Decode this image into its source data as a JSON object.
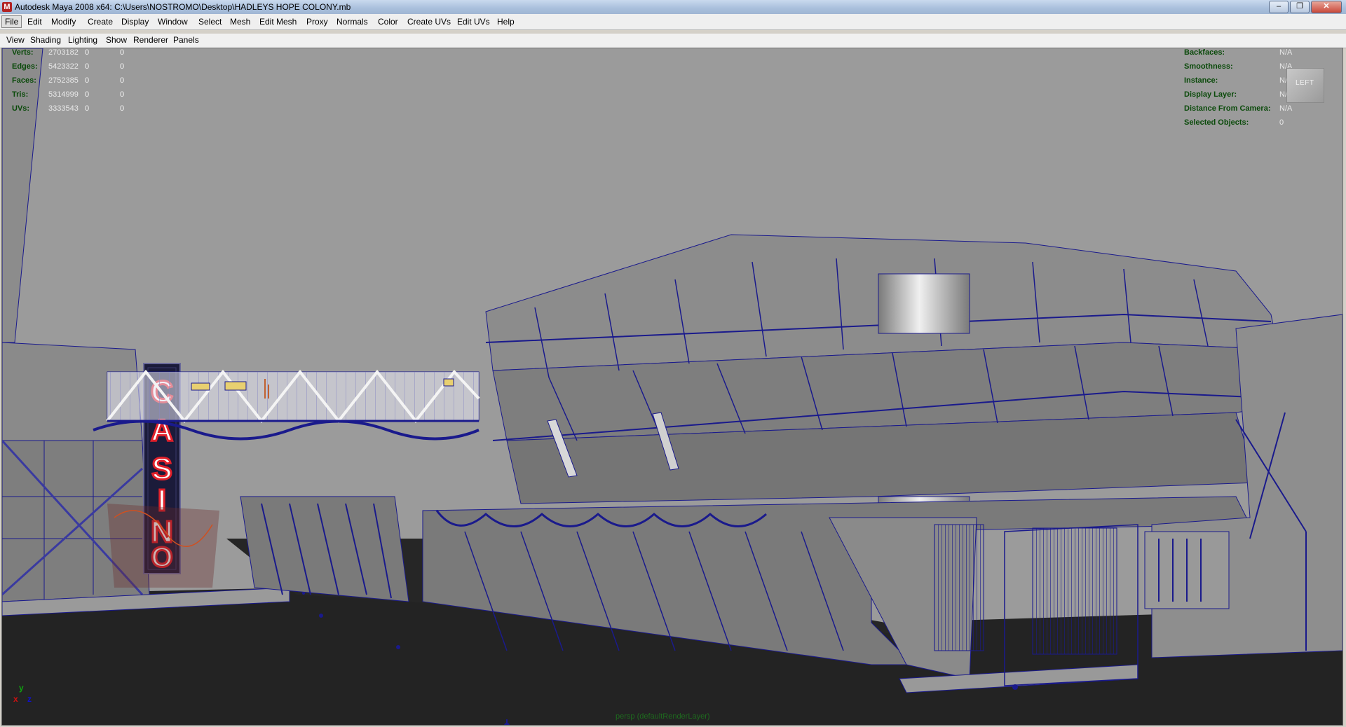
{
  "window": {
    "title": "Autodesk Maya 2008 x64: C:\\Users\\NOSTROMO\\Desktop\\HADLEYS HOPE COLONY.mb",
    "controls": [
      "–",
      "❐",
      "✕"
    ]
  },
  "menubar": {
    "items": [
      "File",
      "Edit",
      "Modify",
      "Create",
      "Display",
      "Window",
      "Select",
      "Mesh",
      "Edit Mesh",
      "Proxy",
      "Normals",
      "Color",
      "Create UVs",
      "Edit UVs",
      "Help"
    ],
    "active": "File"
  },
  "panel_menu": {
    "items": [
      "View",
      "Shading",
      "Lighting",
      "Show",
      "Renderer",
      "Panels"
    ]
  },
  "hud_left": [
    {
      "label": "Verts:",
      "value": "2703182",
      "sel": "0",
      "comp": "0"
    },
    {
      "label": "Edges:",
      "value": "5423322",
      "sel": "0",
      "comp": "0"
    },
    {
      "label": "Faces:",
      "value": "2752385",
      "sel": "0",
      "comp": "0"
    },
    {
      "label": "Tris:",
      "value": "5314999",
      "sel": "0",
      "comp": "0"
    },
    {
      "label": "UVs:",
      "value": "3333543",
      "sel": "0",
      "comp": "0"
    }
  ],
  "hud_right": [
    {
      "label": "Backfaces:",
      "value": "N/A"
    },
    {
      "label": "Smoothness:",
      "value": "N/A"
    },
    {
      "label": "Instance:",
      "value": "N/A"
    },
    {
      "label": "Display Layer:",
      "value": "N/A"
    },
    {
      "label": "Distance From Camera:",
      "value": "N/A"
    },
    {
      "label": "Selected Objects:",
      "value": "0"
    }
  ],
  "viewcube": {
    "label": "LEFT"
  },
  "axis": {
    "y": "y",
    "x": "x",
    "z": "z"
  },
  "camera_label": "persp (defaultRenderLayer)",
  "scene": {
    "sign_text": "CASINO"
  },
  "colors": {
    "wire": "#1a1a8c",
    "sign_red": "#e0202a",
    "axis_x": "#d01010",
    "axis_y": "#10a010",
    "axis_z": "#1010d0"
  }
}
